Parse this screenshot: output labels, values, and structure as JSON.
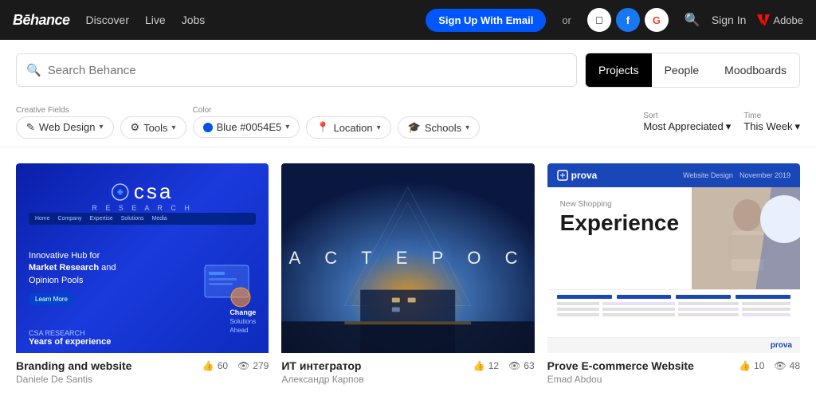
{
  "navbar": {
    "logo": "Bēhance",
    "links": [
      {
        "label": "Discover",
        "id": "discover"
      },
      {
        "label": "Live",
        "id": "live"
      },
      {
        "label": "Jobs",
        "id": "jobs"
      }
    ],
    "signup_label": "Sign Up With Email",
    "or_label": "or",
    "signin_label": "Sign In",
    "adobe_label": "Adobe"
  },
  "search": {
    "placeholder": "Search Behance",
    "tabs": [
      {
        "label": "Projects",
        "active": true
      },
      {
        "label": "People",
        "active": false
      },
      {
        "label": "Moodboards",
        "active": false
      }
    ]
  },
  "filters": {
    "creative_fields_label": "Creative Fields",
    "creative_fields_value": "Web Design",
    "tools_label": "Tools",
    "color_label": "Color",
    "color_value": "Blue #0054E5",
    "location_label": "Location",
    "schools_label": "Schools",
    "sort_label": "Sort",
    "sort_value": "Most Appreciated",
    "time_label": "Time",
    "time_value": "This Week"
  },
  "projects": [
    {
      "id": "p1",
      "title": "Branding and website",
      "author": "Daniele De Santis",
      "likes": 60,
      "views": 279,
      "thumb_type": "csa"
    },
    {
      "id": "p2",
      "title": "ИТ интегратор",
      "author": "Александр Карпов",
      "likes": 12,
      "views": 63,
      "thumb_type": "asteroc"
    },
    {
      "id": "p3",
      "title": "Prove E-commerce Website",
      "author": "Emad Abdou",
      "likes": 10,
      "views": 48,
      "thumb_type": "prova"
    }
  ]
}
